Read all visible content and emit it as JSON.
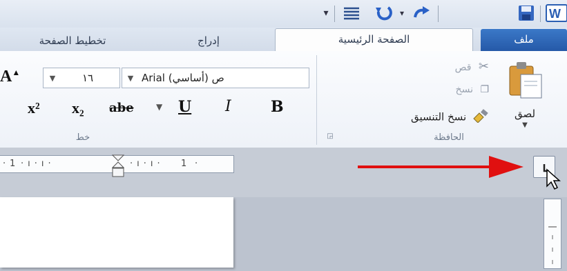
{
  "tabs": {
    "file": "ملف",
    "home": "الصفحة الرئيسية",
    "insert": "إدراج",
    "page_layout": "تخطيط الصفحة"
  },
  "clipboard": {
    "paste": "لصق",
    "cut": "قص",
    "copy": "نسخ",
    "format_painter": "نسخ التنسيق",
    "group_label": "الحافظة"
  },
  "font": {
    "font_name": "Arial (أساسي) ص",
    "font_size": "١٦",
    "group_label": "خط",
    "bold": "B",
    "italic": "I",
    "underline": "U",
    "strikethrough": "abe",
    "subscript": "x₂",
    "superscript": "x²",
    "grow": "A"
  },
  "ruler": {
    "marks": [
      "1",
      "1"
    ]
  },
  "colors": {
    "arrow": "#e01010",
    "file_tab": "#2b62b3"
  },
  "icons": [
    "undo-icon",
    "redo-icon",
    "save-icon",
    "word-icon",
    "paragraph-icon",
    "paste-icon",
    "scissors-icon",
    "copy-icon",
    "format-painter-icon",
    "dropdown-icon",
    "tab-selector-icon",
    "cursor-icon",
    "arrow-icon"
  ]
}
